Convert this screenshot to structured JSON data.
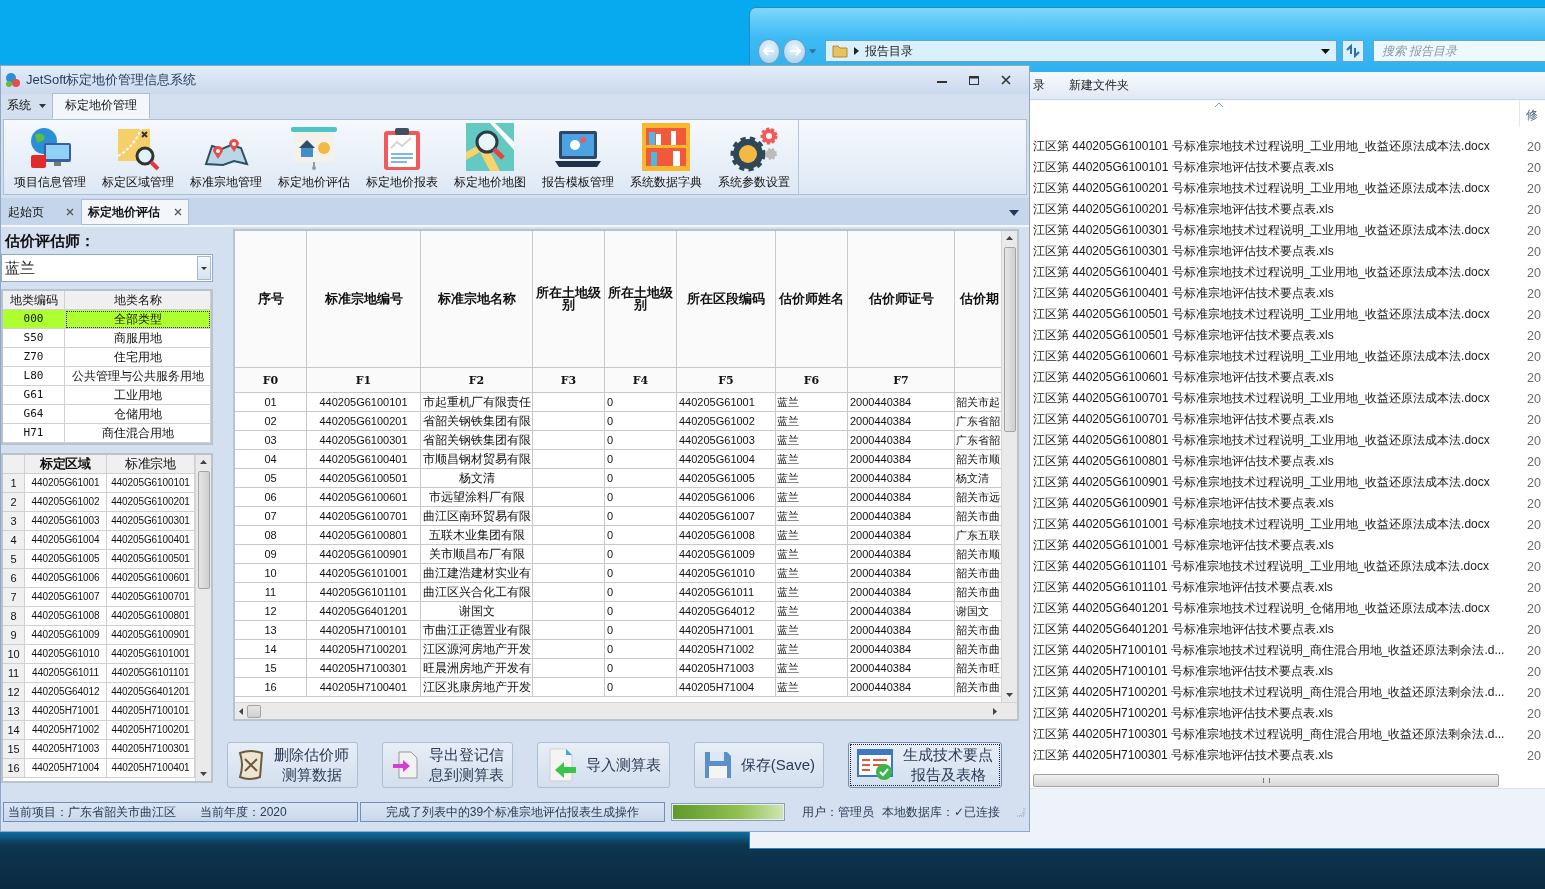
{
  "explorer": {
    "address": "报告目录",
    "search": {
      "placeholder": "搜索 报告目录"
    },
    "commands": [
      "录",
      "新建文件夹"
    ],
    "columns": [
      "修"
    ],
    "files": [
      {
        "name": "江区第 440205G6100101 号标准宗地技术过程说明_工业用地_收益还原法成本法.docx",
        "date": "20"
      },
      {
        "name": "江区第 440205G6100101 号标准宗地评估技术要点表.xls",
        "date": "20"
      },
      {
        "name": "江区第 440205G6100201 号标准宗地技术过程说明_工业用地_收益还原法成本法.docx",
        "date": "20"
      },
      {
        "name": "江区第 440205G6100201 号标准宗地评估技术要点表.xls",
        "date": "20"
      },
      {
        "name": "江区第 440205G6100301 号标准宗地技术过程说明_工业用地_收益还原法成本法.docx",
        "date": "20"
      },
      {
        "name": "江区第 440205G6100301 号标准宗地评估技术要点表.xls",
        "date": "20"
      },
      {
        "name": "江区第 440205G6100401 号标准宗地技术过程说明_工业用地_收益还原法成本法.docx",
        "date": "20"
      },
      {
        "name": "江区第 440205G6100401 号标准宗地评估技术要点表.xls",
        "date": "20"
      },
      {
        "name": "江区第 440205G6100501 号标准宗地技术过程说明_工业用地_收益还原法成本法.docx",
        "date": "20"
      },
      {
        "name": "江区第 440205G6100501 号标准宗地评估技术要点表.xls",
        "date": "20"
      },
      {
        "name": "江区第 440205G6100601 号标准宗地技术过程说明_工业用地_收益还原法成本法.docx",
        "date": "20"
      },
      {
        "name": "江区第 440205G6100601 号标准宗地评估技术要点表.xls",
        "date": "20"
      },
      {
        "name": "江区第 440205G6100701 号标准宗地技术过程说明_工业用地_收益还原法成本法.docx",
        "date": "20"
      },
      {
        "name": "江区第 440205G6100701 号标准宗地评估技术要点表.xls",
        "date": "20"
      },
      {
        "name": "江区第 440205G6100801 号标准宗地技术过程说明_工业用地_收益还原法成本法.docx",
        "date": "20"
      },
      {
        "name": "江区第 440205G6100801 号标准宗地评估技术要点表.xls",
        "date": "20"
      },
      {
        "name": "江区第 440205G6100901 号标准宗地技术过程说明_工业用地_收益还原法成本法.docx",
        "date": "20"
      },
      {
        "name": "江区第 440205G6100901 号标准宗地评估技术要点表.xls",
        "date": "20"
      },
      {
        "name": "江区第 440205G6101001 号标准宗地技术过程说明_工业用地_收益还原法成本法.docx",
        "date": "20"
      },
      {
        "name": "江区第 440205G6101001 号标准宗地评估技术要点表.xls",
        "date": "20"
      },
      {
        "name": "江区第 440205G6101101 号标准宗地技术过程说明_工业用地_收益还原法成本法.docx",
        "date": "20"
      },
      {
        "name": "江区第 440205G6101101 号标准宗地评估技术要点表.xls",
        "date": "20"
      },
      {
        "name": "江区第 440205G6401201 号标准宗地技术过程说明_仓储用地_收益还原法成本法.docx",
        "date": "20"
      },
      {
        "name": "江区第 440205G6401201 号标准宗地评估技术要点表.xls",
        "date": "20"
      },
      {
        "name": "江区第 440205H7100101 号标准宗地技术过程说明_商住混合用地_收益还原法剩余法.d...",
        "date": "20"
      },
      {
        "name": "江区第 440205H7100101 号标准宗地评估技术要点表.xls",
        "date": "20"
      },
      {
        "name": "江区第 440205H7100201 号标准宗地技术过程说明_商住混合用地_收益还原法剩余法.d...",
        "date": "20"
      },
      {
        "name": "江区第 440205H7100201 号标准宗地评估技术要点表.xls",
        "date": "20"
      },
      {
        "name": "江区第 440205H7100301 号标准宗地技术过程说明_商住混合用地_收益还原法剩余法.d...",
        "date": "20"
      },
      {
        "name": "江区第 440205H7100301 号标准宗地评估技术要点表.xls",
        "date": "20"
      }
    ]
  },
  "app": {
    "title": "JetSoft标定地价管理信息系统",
    "menu_tabs": [
      {
        "label": "系统",
        "selected": false
      },
      {
        "label": "标定地价管理",
        "selected": true
      }
    ],
    "ribbon": [
      "项目信息管理",
      "标定区域管理",
      "标准宗地管理",
      "标定地价评估",
      "标定地价报表",
      "标定地价地图",
      "报告模板管理",
      "系统数据字典",
      "系统参数设置"
    ],
    "doc_tabs": [
      {
        "label": "起始页",
        "selected": false
      },
      {
        "label": "标定地价评估",
        "selected": true
      }
    ],
    "appraiser": {
      "label": "估价评估师：",
      "value": "蓝兰"
    },
    "land_types": {
      "columns": [
        "地类编码",
        "地类名称"
      ],
      "rows": [
        {
          "code": "000",
          "name": "全部类型",
          "selected": true
        },
        {
          "code": "S50",
          "name": "商服用地",
          "selected": false
        },
        {
          "code": "Z70",
          "name": "住宅用地",
          "selected": false
        },
        {
          "code": "L80",
          "name": "公共管理与公共服务用地",
          "selected": false
        },
        {
          "code": "G61",
          "name": "工业用地",
          "selected": false
        },
        {
          "code": "G64",
          "name": "仓储用地",
          "selected": false
        },
        {
          "code": "H71",
          "name": "商住混合用地",
          "selected": false
        }
      ]
    },
    "regions": {
      "columns": [
        {
          "label": "标定区域",
          "selected": true
        },
        {
          "label": "标准宗地",
          "selected": false
        }
      ],
      "rows": [
        {
          "index": "1",
          "region": "440205G61001",
          "parcel": "440205G6100101"
        },
        {
          "index": "2",
          "region": "440205G61002",
          "parcel": "440205G6100201"
        },
        {
          "index": "3",
          "region": "440205G61003",
          "parcel": "440205G6100301"
        },
        {
          "index": "4",
          "region": "440205G61004",
          "parcel": "440205G6100401"
        },
        {
          "index": "5",
          "region": "440205G61005",
          "parcel": "440205G6100501"
        },
        {
          "index": "6",
          "region": "440205G61006",
          "parcel": "440205G6100601"
        },
        {
          "index": "7",
          "region": "440205G61007",
          "parcel": "440205G6100701"
        },
        {
          "index": "8",
          "region": "440205G61008",
          "parcel": "440205G6100801"
        },
        {
          "index": "9",
          "region": "440205G61009",
          "parcel": "440205G6100901"
        },
        {
          "index": "10",
          "region": "440205G61010",
          "parcel": "440205G6101001"
        },
        {
          "index": "11",
          "region": "440205G61011",
          "parcel": "440205G6101101"
        },
        {
          "index": "12",
          "region": "440205G64012",
          "parcel": "440205G6401201"
        },
        {
          "index": "13",
          "region": "440205H71001",
          "parcel": "440205H7100101"
        },
        {
          "index": "14",
          "region": "440205H71002",
          "parcel": "440205H7100201"
        },
        {
          "index": "15",
          "region": "440205H71003",
          "parcel": "440205H7100301"
        },
        {
          "index": "16",
          "region": "440205H71004",
          "parcel": "440205H7100401"
        }
      ]
    },
    "grid": {
      "columns": [
        {
          "title": "序号",
          "field": "F0"
        },
        {
          "title": "标准宗地编号",
          "field": "F1"
        },
        {
          "title": "标准宗地名称",
          "field": "F2"
        },
        {
          "title": "所在土地级别",
          "field": "F3"
        },
        {
          "title": "所在土地级别",
          "field": "F4"
        },
        {
          "title": "所在区段编码",
          "field": "F5"
        },
        {
          "title": "估价师姓名",
          "field": "F6"
        },
        {
          "title": "估价师证号",
          "field": "F7"
        },
        {
          "title": "估价期"
        }
      ],
      "rows": [
        {
          "no": "01",
          "code": "440205G6100101",
          "name": "市起重机厂有限责任",
          "grade_b": "0",
          "section": "440205G61001",
          "appraiser": "蓝兰",
          "cert": "2000440384",
          "column_9": "韶关市起"
        },
        {
          "no": "02",
          "code": "440205G6100201",
          "name": "省韶关钢铁集团有限",
          "grade_b": "0",
          "section": "440205G61002",
          "appraiser": "蓝兰",
          "cert": "2000440384",
          "column_9": "广东省韶"
        },
        {
          "no": "03",
          "code": "440205G6100301",
          "name": "省韶关钢铁集团有限",
          "grade_b": "0",
          "section": "440205G61003",
          "appraiser": "蓝兰",
          "cert": "2000440384",
          "column_9": "广东省韶"
        },
        {
          "no": "04",
          "code": "440205G6100401",
          "name": "市顺昌钢材贸易有限",
          "grade_b": "0",
          "section": "440205G61004",
          "appraiser": "蓝兰",
          "cert": "2000440384",
          "column_9": "韶关市顺"
        },
        {
          "no": "05",
          "code": "440205G6100501",
          "name": "杨文清",
          "grade_b": "0",
          "section": "440205G61005",
          "appraiser": "蓝兰",
          "cert": "2000440384",
          "column_9": "杨文清"
        },
        {
          "no": "06",
          "code": "440205G6100601",
          "name": "市远望涂料厂有限",
          "grade_b": "0",
          "section": "440205G61006",
          "appraiser": "蓝兰",
          "cert": "2000440384",
          "column_9": "韶关市远"
        },
        {
          "no": "07",
          "code": "440205G6100701",
          "name": "曲江区南环贸易有限",
          "grade_b": "0",
          "section": "440205G61007",
          "appraiser": "蓝兰",
          "cert": "2000440384",
          "column_9": "韶关市曲"
        },
        {
          "no": "08",
          "code": "440205G6100801",
          "name": "五联木业集团有限",
          "grade_b": "0",
          "section": "440205G61008",
          "appraiser": "蓝兰",
          "cert": "2000440384",
          "column_9": "广东五联"
        },
        {
          "no": "09",
          "code": "440205G6100901",
          "name": "关市顺昌布厂有限",
          "grade_b": "0",
          "section": "440205G61009",
          "appraiser": "蓝兰",
          "cert": "2000440384",
          "column_9": "韶关市顺"
        },
        {
          "no": "10",
          "code": "440205G6101001",
          "name": "曲江建浩建材实业有",
          "grade_b": "0",
          "section": "440205G61010",
          "appraiser": "蓝兰",
          "cert": "2000440384",
          "column_9": "韶关市曲"
        },
        {
          "no": "11",
          "code": "440205G6101101",
          "name": "曲江区兴合化工有限",
          "grade_b": "0",
          "section": "440205G61011",
          "appraiser": "蓝兰",
          "cert": "2000440384",
          "column_9": "韶关市曲"
        },
        {
          "no": "12",
          "code": "440205G6401201",
          "name": "谢国文",
          "grade_b": "0",
          "section": "440205G64012",
          "appraiser": "蓝兰",
          "cert": "2000440384",
          "column_9": "谢国文"
        },
        {
          "no": "13",
          "code": "440205H7100101",
          "name": "市曲江正德置业有限",
          "grade_b": "0",
          "section": "440205H71001",
          "appraiser": "蓝兰",
          "cert": "2000440384",
          "column_9": "韶关市曲"
        },
        {
          "no": "14",
          "code": "440205H7100201",
          "name": "江区源河房地产开发",
          "grade_b": "0",
          "section": "440205H71002",
          "appraiser": "蓝兰",
          "cert": "2000440384",
          "column_9": "韶关市曲"
        },
        {
          "no": "15",
          "code": "440205H7100301",
          "name": "旺晨洲房地产开发有",
          "grade_b": "0",
          "section": "440205H71003",
          "appraiser": "蓝兰",
          "cert": "2000440384",
          "column_9": "韶关市旺"
        },
        {
          "no": "16",
          "code": "440205H7100401",
          "name": "江区兆康房地产开发",
          "grade_b": "0",
          "section": "440205H71004",
          "appraiser": "蓝兰",
          "cert": "2000440384",
          "column_9": "韶关市曲"
        }
      ]
    },
    "buttons": [
      {
        "lines": [
          "删除估价师",
          "测算数据"
        ],
        "focused": false
      },
      {
        "lines": [
          "导出登记信",
          "息到测算表"
        ],
        "focused": false
      },
      {
        "lines": [
          "导入测算表"
        ],
        "focused": false
      },
      {
        "lines": [
          "保存(Save)"
        ],
        "focused": false
      },
      {
        "lines": [
          "生成技术要点",
          "报告及表格"
        ],
        "focused": true
      }
    ],
    "status": {
      "project": "当前项目：广东省韶关市曲江区",
      "year": "当前年度：2020",
      "message": "完成了列表中的39个标准宗地评估报表生成操作",
      "progress": {
        "level": 1
      },
      "user": "用户：管理员",
      "database": "本地数据库：✓已连接"
    }
  }
}
